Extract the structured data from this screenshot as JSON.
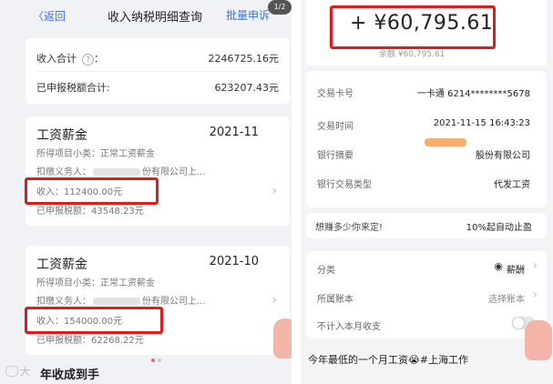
{
  "left": {
    "header": {
      "back_label": "〈返回",
      "title": "收入纳税明细查询",
      "batch_label": "批量申诉",
      "page_badge": "1/2"
    },
    "summary": {
      "income_total_label": "收入合计",
      "income_total_value": "2246725.16元",
      "tax_total_label": "已申报税额合计:",
      "tax_total_value": "623207.43元"
    },
    "records": [
      {
        "title": "工资薪金",
        "period": "2021-11",
        "subcategory": "所得项目小类：正常工资薪金",
        "withholder_prefix": "扣缴义务人：",
        "withholder_suffix": "份有限公司上...",
        "income": "收入：112400.00元",
        "tax": "已申报税额：43548.23元"
      },
      {
        "title": "工资薪金",
        "period": "2021-10",
        "subcategory": "所得项目小类：正常工资薪金",
        "withholder_prefix": "扣缴义务人：",
        "withholder_suffix": "份有限公司上...",
        "income": "收入：154000.00元",
        "tax": "已申报税额：62268.22元"
      }
    ],
    "bottom_text": "年收成到手",
    "watermark": "大",
    "colors": {
      "accent": "#3c73e8",
      "highlight": "#e41a1a"
    }
  },
  "right": {
    "amount": "+ ¥60,795.61",
    "balance": "余额 ¥60,795.61",
    "details": [
      {
        "label": "交易卡号",
        "value": "一卡通 6214********5678"
      },
      {
        "label": "交易时间",
        "value": "2021-11-15 16:43:23"
      },
      {
        "label": "银行摘要",
        "value": "股份有限公司"
      },
      {
        "label": "银行交易类型",
        "value": "代发工资"
      }
    ],
    "promo": {
      "left": "想赚多少你来定!",
      "right": "10%起自动止盈"
    },
    "classify": {
      "label": "分类",
      "value": "薪酬",
      "account_label": "所属账本",
      "account_value": "选择账本",
      "exclude_label": "不计入本月收支"
    },
    "note": "今年最低的一个月工资😭#上海工作"
  }
}
